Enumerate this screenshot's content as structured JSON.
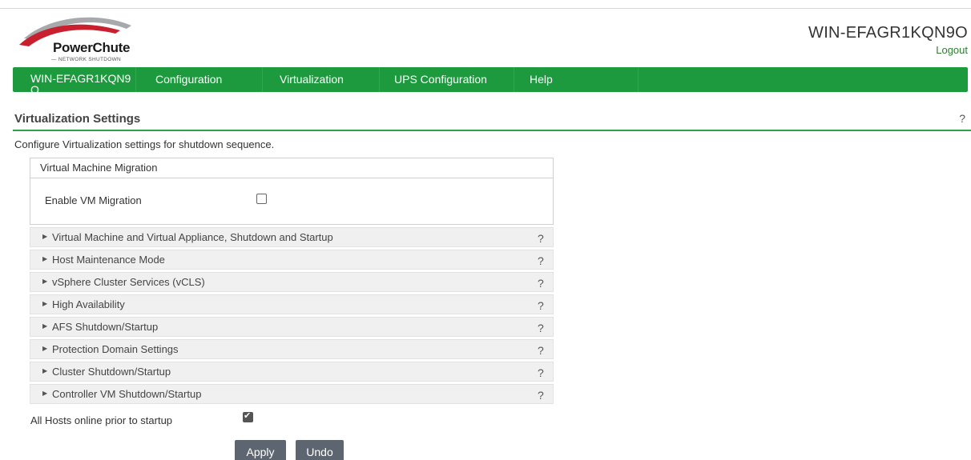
{
  "brand": {
    "name": "PowerChute",
    "tagline": "— NETWORK SHUTDOWN",
    "colors": {
      "arc_red": "#c8202f",
      "arc_gray": "#a7a9ac",
      "nav_green": "#1e9a3e"
    }
  },
  "header": {
    "host_title": "WIN-EFAGR1KQN9O",
    "logout_label": "Logout"
  },
  "nav": {
    "items": [
      {
        "label": "WIN-EFAGR1KQN9O"
      },
      {
        "label": "Configuration"
      },
      {
        "label": "Virtualization"
      },
      {
        "label": "UPS Configuration"
      },
      {
        "label": "Help"
      }
    ]
  },
  "page": {
    "title": "Virtualization Settings",
    "help_glyph": "?",
    "description": "Configure Virtualization settings for shutdown sequence."
  },
  "migration": {
    "header": "Virtual Machine Migration",
    "enable_label": "Enable VM Migration",
    "enabled": false
  },
  "sections": [
    {
      "label": "Virtual Machine and Virtual Appliance, Shutdown and Startup",
      "help": "?"
    },
    {
      "label": "Host Maintenance Mode",
      "help": "?"
    },
    {
      "label": "vSphere Cluster Services (vCLS)",
      "help": "?"
    },
    {
      "label": "High Availability",
      "help": "?"
    },
    {
      "label": "AFS Shutdown/Startup",
      "help": "?"
    },
    {
      "label": "Protection Domain Settings",
      "help": "?"
    },
    {
      "label": "Cluster Shutdown/Startup",
      "help": "?"
    },
    {
      "label": "Controller VM Shutdown/Startup",
      "help": "?"
    }
  ],
  "hosts_online": {
    "label": "All Hosts online prior to startup",
    "checked": true
  },
  "buttons": {
    "apply": "Apply",
    "undo": "Undo"
  }
}
